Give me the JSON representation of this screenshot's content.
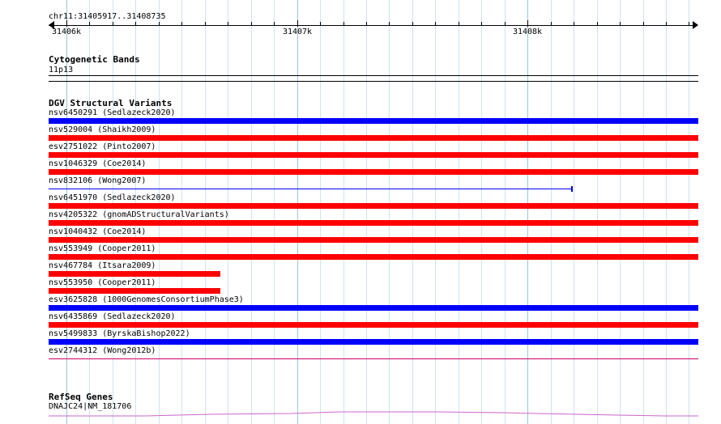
{
  "region": {
    "label": "chr11:31405917..31408735"
  },
  "ruler": {
    "ticks": [
      {
        "label": "31406k"
      },
      {
        "label": "31407k"
      },
      {
        "label": "31408k"
      }
    ]
  },
  "tracks": {
    "cytoband": {
      "title": "Cytogenetic Bands",
      "band_label": "11p13"
    },
    "dgv": {
      "title": "DGV Structural Variants",
      "colors": {
        "blue": "#0000ff",
        "red": "#ff0000",
        "gain_loss": "#cc0066"
      },
      "features": [
        {
          "label": "nsv6450291 (Sedlazeck2020)",
          "color": "#0000ff",
          "style": "thick",
          "end_fraction": 1.0
        },
        {
          "label": "nsv529004 (Shaikh2009)",
          "color": "#ff0000",
          "style": "thick",
          "end_fraction": 1.0
        },
        {
          "label": "esv2751022 (Pinto2007)",
          "color": "#ff0000",
          "style": "thick",
          "end_fraction": 1.0
        },
        {
          "label": "nsv1046329 (Coe2014)",
          "color": "#ff0000",
          "style": "thick",
          "end_fraction": 1.0
        },
        {
          "label": "nsv832106 (Wong2007)",
          "color": "#0000ff",
          "style": "thin",
          "end_fraction": 0.806
        },
        {
          "label": "nsv6451970 (Sedlazeck2020)",
          "color": "#ff0000",
          "style": "thick",
          "end_fraction": 1.0
        },
        {
          "label": "nsv4205322 (gnomADStructuralVariants)",
          "color": "#ff0000",
          "style": "thick",
          "end_fraction": 1.0
        },
        {
          "label": "nsv1040432 (Coe2014)",
          "color": "#ff0000",
          "style": "thick",
          "end_fraction": 1.0
        },
        {
          "label": "nsv553949 (Cooper2011)",
          "color": "#ff0000",
          "style": "thick",
          "end_fraction": 1.0
        },
        {
          "label": "nsv467784 (Itsara2009)",
          "color": "#ff0000",
          "style": "thick",
          "end_fraction": 0.264
        },
        {
          "label": "nsv553950 (Cooper2011)",
          "color": "#ff0000",
          "style": "thick",
          "end_fraction": 0.264
        },
        {
          "label": "esv3625828 (1000GenomesConsortiumPhase3)",
          "color": "#0000ff",
          "style": "thick",
          "end_fraction": 1.0
        },
        {
          "label": "nsv6435869 (Sedlazeck2020)",
          "color": "#ff0000",
          "style": "thick",
          "end_fraction": 1.0
        },
        {
          "label": "nsv5499833 (ByrskaBishop2022)",
          "color": "#0000ff",
          "style": "thick",
          "end_fraction": 1.0
        },
        {
          "label": "esv2744312 (Wong2012b)",
          "color": "#cc0066",
          "style": "thin",
          "end_fraction": 1.0
        }
      ]
    },
    "refseq": {
      "title": "RefSeq Genes",
      "gene_label": "DNAJC24|NM_181706",
      "color": "#cc66cc"
    }
  }
}
